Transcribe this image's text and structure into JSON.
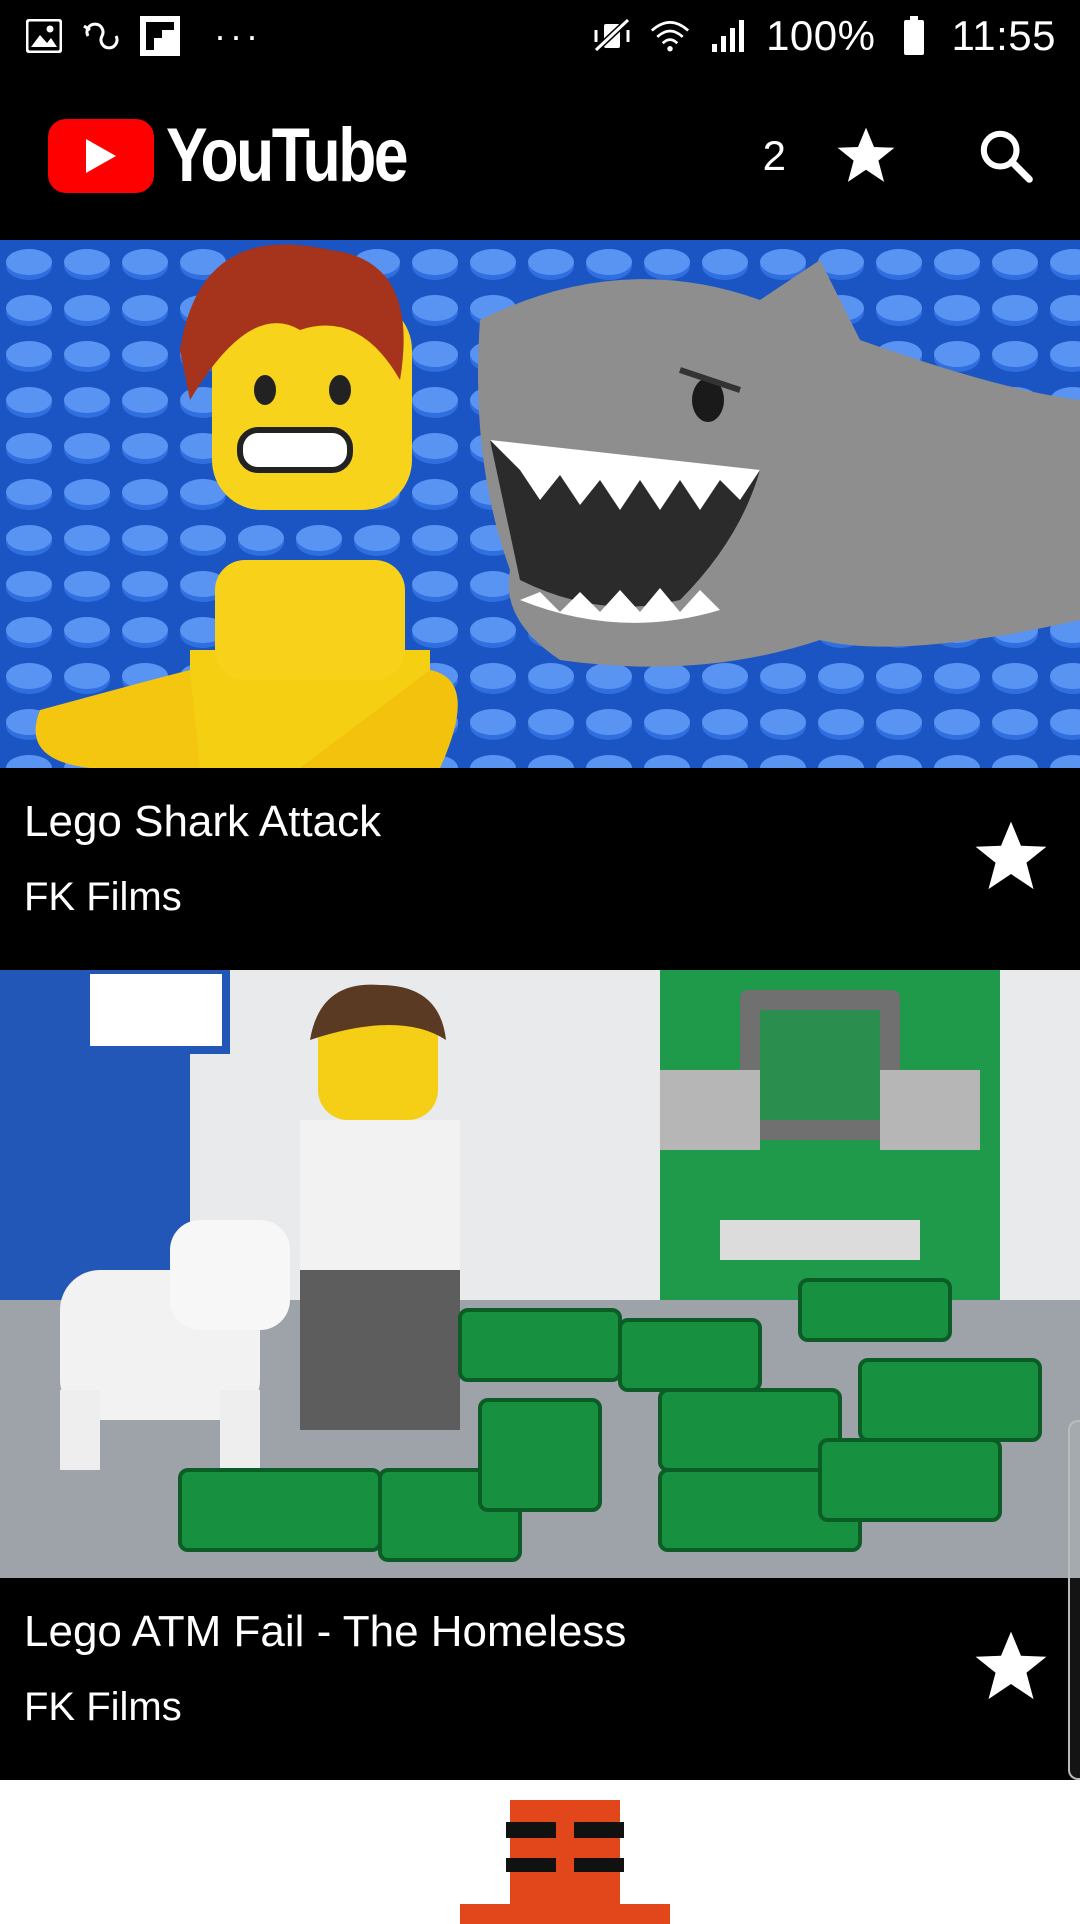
{
  "status_bar": {
    "battery": "100%",
    "time": "11:55",
    "left_icons": [
      "image-icon",
      "loop-icon",
      "flipboard-icon"
    ],
    "more": "···"
  },
  "app_bar": {
    "logo_text": "YouTube",
    "favorites_count": "2"
  },
  "videos": [
    {
      "title": "Lego Shark Attack",
      "channel": "FK Films"
    },
    {
      "title": "Lego ATM Fail - The Homeless",
      "channel": "FK Films"
    }
  ],
  "colors": {
    "background": "#000000",
    "youtube_red": "#ff0000",
    "text": "#ffffff"
  }
}
